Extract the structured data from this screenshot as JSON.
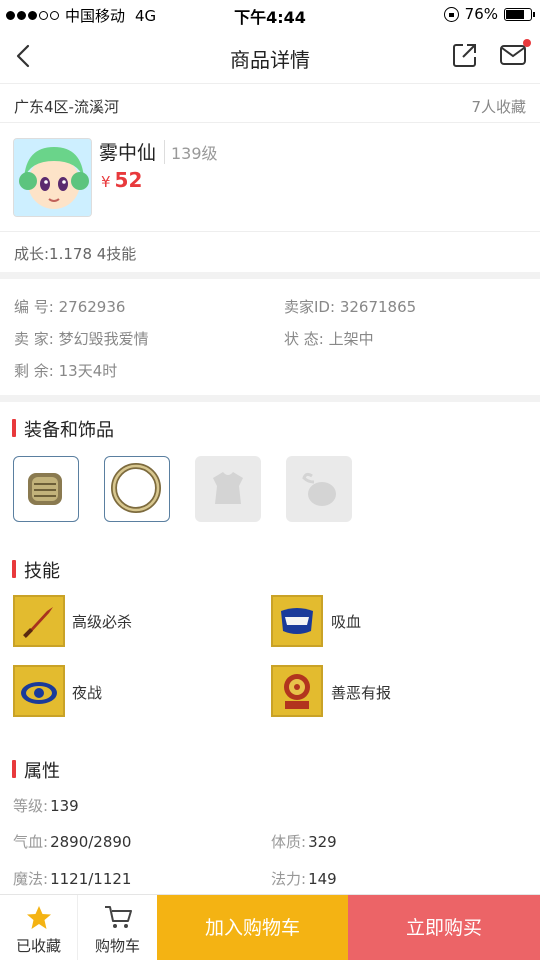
{
  "status_bar": {
    "carrier": "中国移动",
    "network": "4G",
    "time": "下午4:44",
    "battery": "76%",
    "battery_level": 0.76
  },
  "nav": {
    "title": "商品详情",
    "back_icon": "chevron-left-icon",
    "share_icon": "share-icon",
    "mail_icon": "mail-icon"
  },
  "server": {
    "name": "广东4区-流溪河",
    "favorites": "7人收藏"
  },
  "product": {
    "name": "雾中仙",
    "level": "139级",
    "currency": "¥",
    "price": "52",
    "growth": "成长:1.178 4技能"
  },
  "info": {
    "id_label": "编  号:",
    "id_value": "2762936",
    "seller_id_label": "卖家ID:",
    "seller_id_value": "32671865",
    "seller_label": "卖  家:",
    "seller_value": "梦幻毁我爱情",
    "status_label": "状  态:",
    "status_value": "上架中",
    "remaining_label": "剩  余:",
    "remaining_value": "13天4时"
  },
  "equipment": {
    "title": "装备和饰品",
    "slots": [
      "bracer-icon",
      "ring-icon",
      "armor-placeholder-icon",
      "pouch-placeholder-icon"
    ]
  },
  "skills": {
    "title": "技能",
    "items": [
      {
        "name": "高级必杀",
        "icon": "sword-icon"
      },
      {
        "name": "吸血",
        "icon": "fang-icon"
      },
      {
        "name": "夜战",
        "icon": "eye-icon"
      },
      {
        "name": "善恶有报",
        "icon": "wheel-icon"
      }
    ]
  },
  "attributes": {
    "title": "属性",
    "level_label": "等级:",
    "level_value": "139",
    "hp_label": "气血:",
    "hp_value": "2890/2890",
    "con_label": "体质:",
    "con_value": "329",
    "mp_label": "魔法:",
    "mp_value": "1121/1121",
    "mag_label": "法力:",
    "mag_value": "149"
  },
  "bottom_bar": {
    "favorited_label": "已收藏",
    "cart_label": "购物车",
    "add_to_cart": "加入购物车",
    "buy_now": "立即购买"
  },
  "colors": {
    "accent_red": "#e8393c",
    "add_cart_yellow": "#f4b313",
    "buy_red": "#ec6467"
  }
}
